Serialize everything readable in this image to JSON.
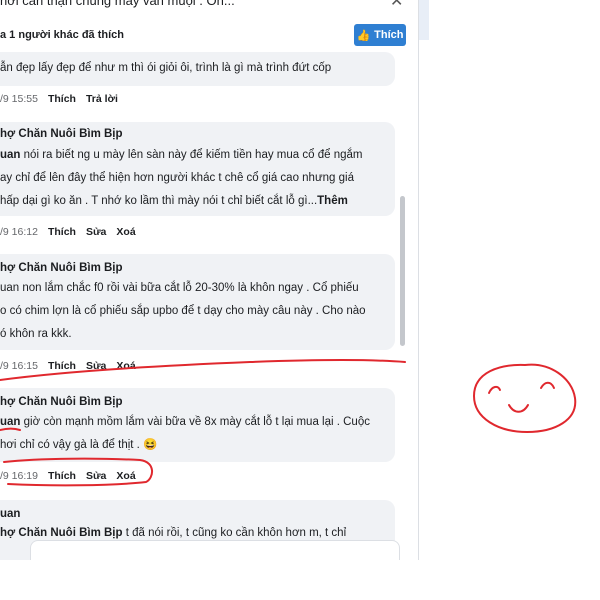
{
  "dialog": {
    "title": "hơi cẩn thận chung mấy vấn       muội . Oh...",
    "likes_summary": "a 1 người khác đã thích",
    "like_button_label": "Thích"
  },
  "comments": [
    {
      "author": "",
      "lines": [
        "ẫn đẹp lấy đẹp để như m thì ói giỏi ôi, trình là gì mà trình đứt cốp"
      ],
      "time": "/9 15:55",
      "actions": [
        "Thích",
        "Trả lời"
      ]
    },
    {
      "author": "hợ Chăn Nuôi Bìm Bịp",
      "mention": "uan",
      "lines": [
        " nói ra biết ng u mày lên sàn này để kiếm tiền hay mua cổ để ngắm",
        "ay chỉ để lên đây thể hiện hơn người khác t chê cổ giá cao nhưng giá",
        "hấp dại gì ko ăn . T nhớ ko lầm thì mày nói t chỉ biết cắt lỗ gì..."
      ],
      "more": "Thêm",
      "time": "/9 16:12",
      "actions": [
        "Thích",
        "Sửa",
        "Xoá"
      ]
    },
    {
      "author": "hợ Chăn Nuôi Bìm Bịp",
      "lines": [
        "uan non lắm chắc f0 rồi vài bữa cắt lỗ 20-30% là khôn ngay . Cổ phiếu",
        "o có chim lợn là cổ phiếu sắp upbo để t dạy cho mày câu này . Cho nào",
        "ó khôn ra kkk."
      ],
      "time": "/9 16:15",
      "actions": [
        "Thích",
        "Sửa",
        "Xoá"
      ]
    },
    {
      "author": "hợ Chăn Nuôi Bìm Bịp",
      "mention": "uan",
      "lines": [
        " giờ còn mạnh mồm lắm vài bữa về 8x mày cắt lỗ t lại mua lại . Cuộc",
        "hơi chỉ có vậy gà là để thịt . "
      ],
      "emoji": "😆",
      "time": "/9 16:19",
      "actions": [
        "Thích",
        "Sửa",
        "Xoá"
      ]
    },
    {
      "author": "uan",
      "reply_author": "hợ Chăn Nuôi Bìm Bịp",
      "lines": [
        " t đã nói rồi, t cũng ko cần khôn hơn m, t chỉ"
      ]
    }
  ],
  "colors": {
    "bubble": "#f0f2f5",
    "like_button": "#2f7fd2",
    "annotation_red": "#e0282e"
  },
  "icons": [
    "close-icon",
    "thumbs-up-icon",
    "laughing-emoji-icon"
  ]
}
